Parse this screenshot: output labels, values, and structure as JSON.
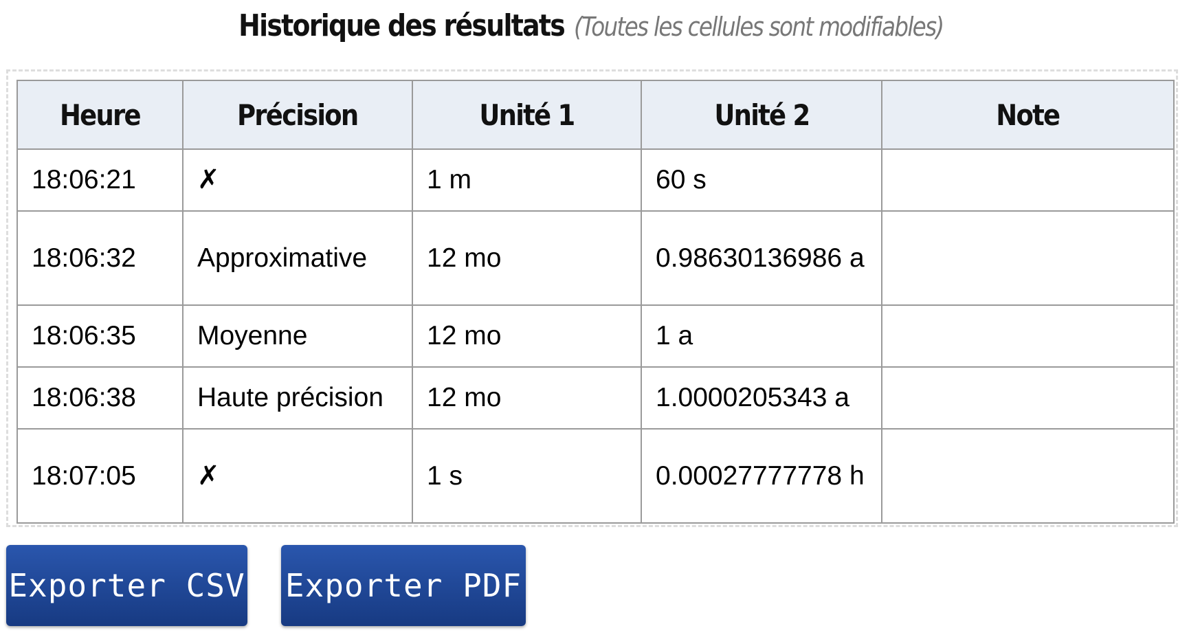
{
  "header": {
    "title": "Historique des résultats",
    "subtitle": "(Toutes les cellules sont modifiables)"
  },
  "table": {
    "columns": [
      "Heure",
      "Précision",
      "Unité 1",
      "Unité 2",
      "Note"
    ],
    "rows": [
      {
        "heure": "18:06:21",
        "precision": "✗",
        "unite1": "1 m",
        "unite2": "60 s",
        "note": ""
      },
      {
        "heure": "18:06:32",
        "precision": "Approximative",
        "unite1": "12 mo",
        "unite2": "0.98630136986 a",
        "note": ""
      },
      {
        "heure": "18:06:35",
        "precision": "Moyenne",
        "unite1": "12 mo",
        "unite2": "1 a",
        "note": ""
      },
      {
        "heure": "18:06:38",
        "precision": "Haute précision",
        "unite1": "12 mo",
        "unite2": "1.0000205343 a",
        "note": ""
      },
      {
        "heure": "18:07:05",
        "precision": "✗",
        "unite1": "1 s",
        "unite2": "0.00027777778 h",
        "note": ""
      }
    ]
  },
  "actions": {
    "export_csv_label": "Exporter CSV",
    "export_pdf_label": "Exporter PDF"
  },
  "colors": {
    "header_bg": "#e9eef5",
    "border": "#9a9a9a",
    "button_bg": "#1f4a9a",
    "button_text": "#ffffff"
  }
}
